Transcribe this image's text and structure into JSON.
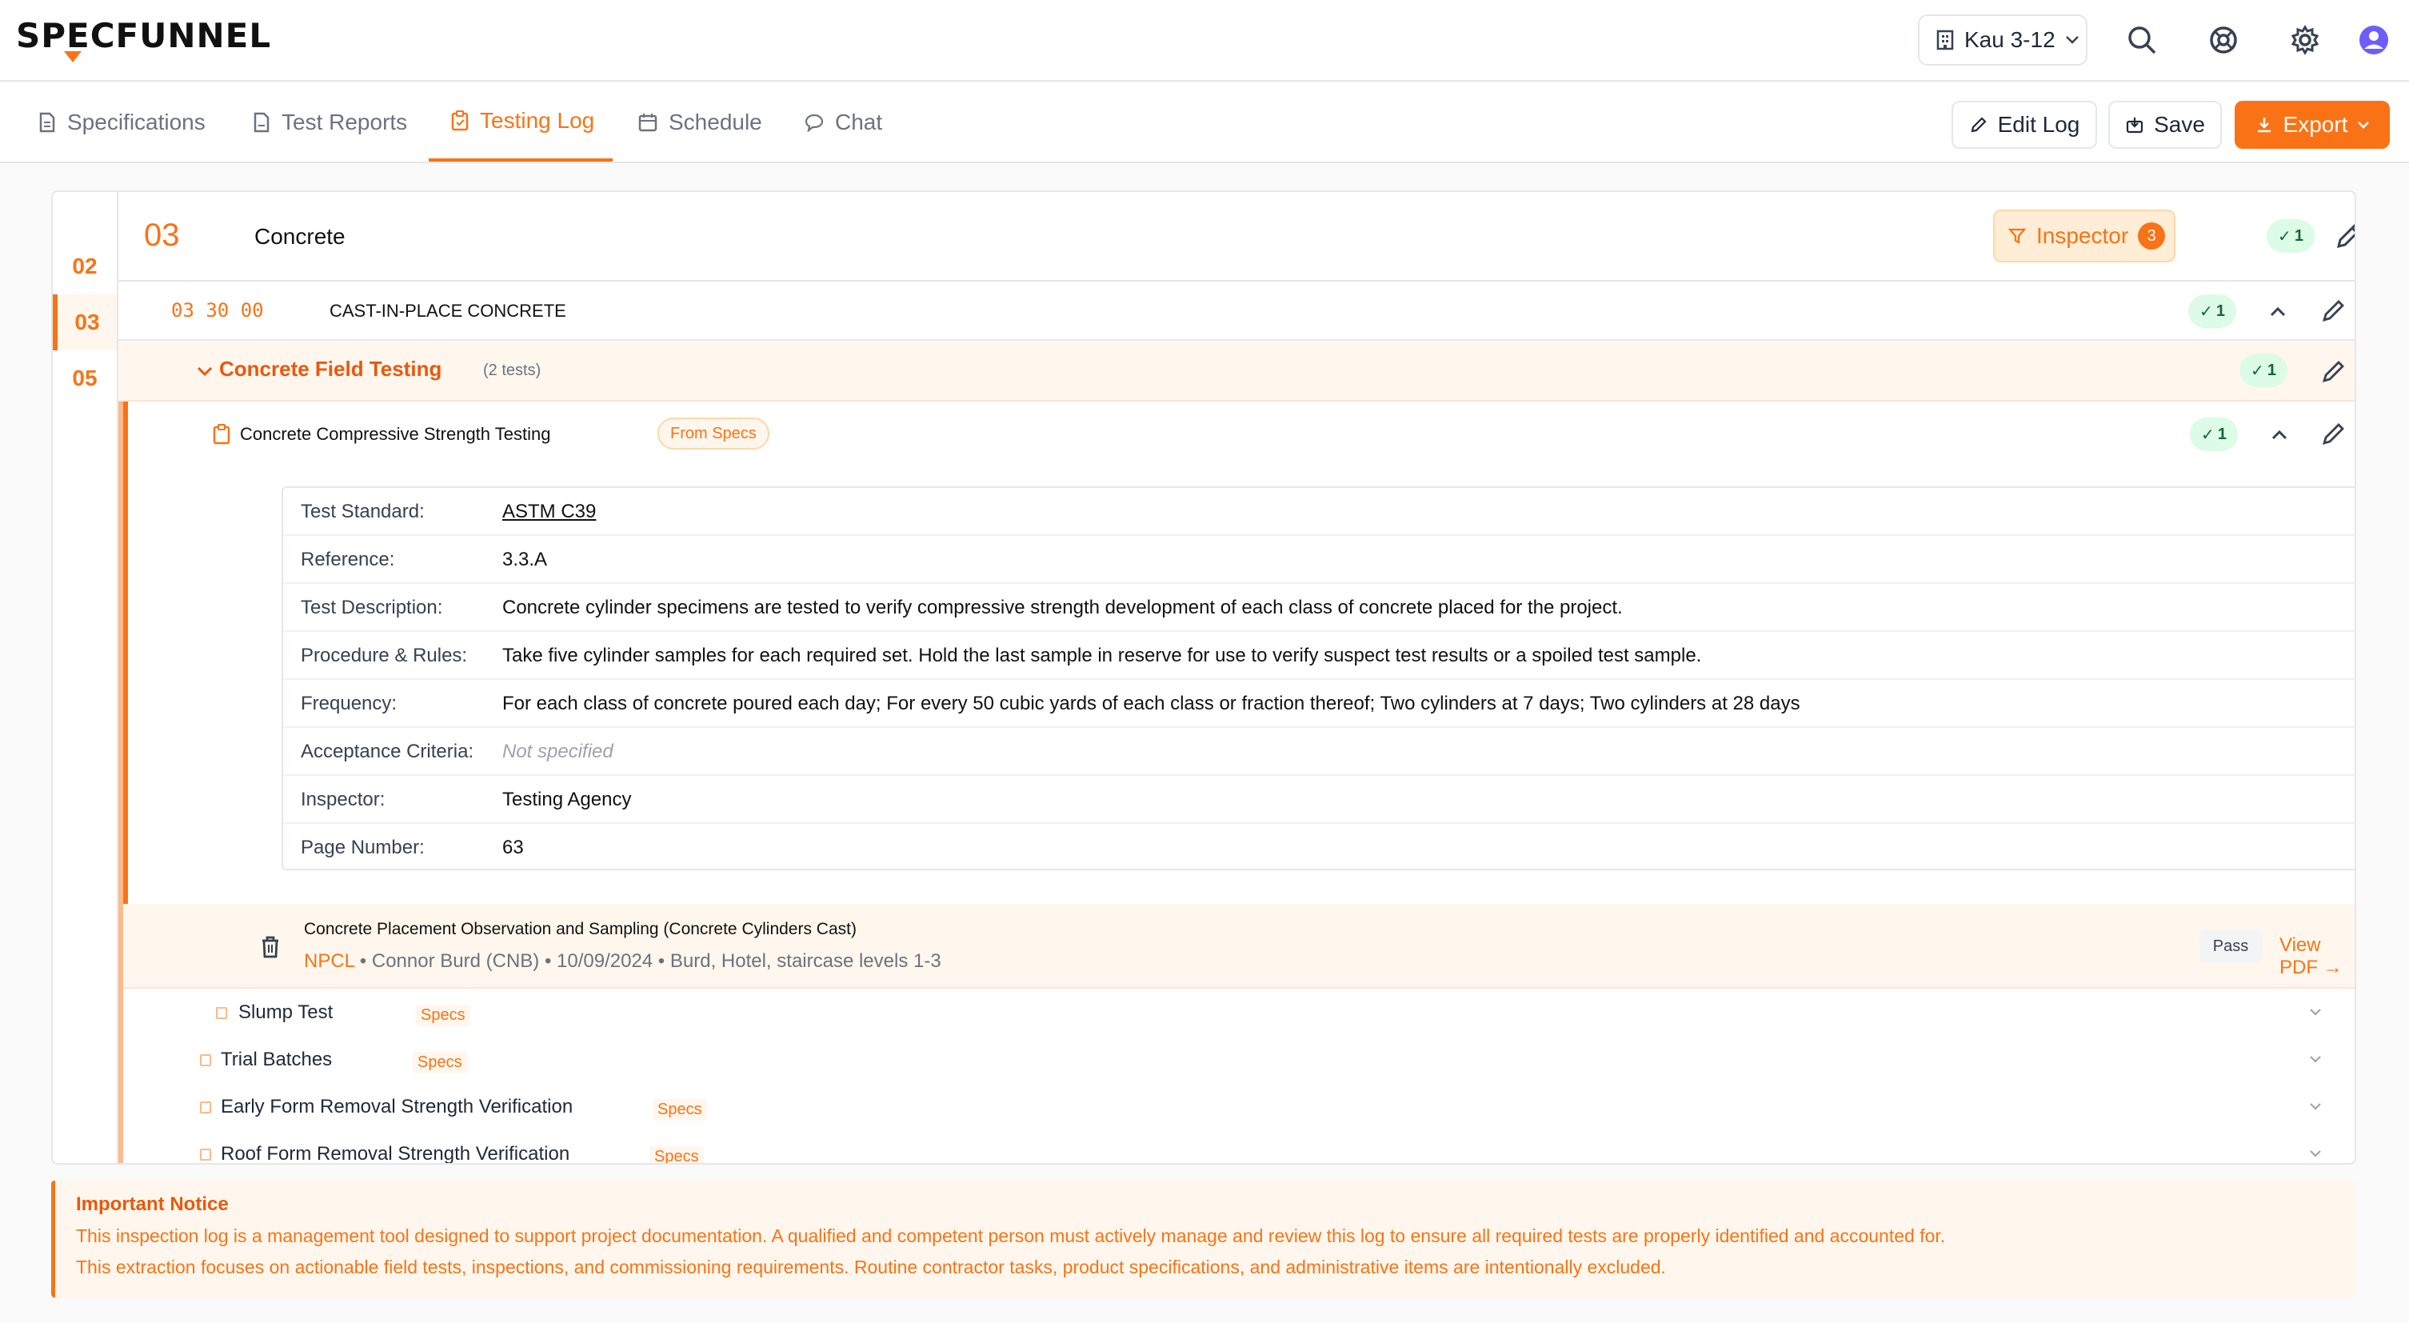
{
  "brand": {
    "logo_text": "SPECFUNNEL",
    "accent": "#f97316"
  },
  "header": {
    "project": "Kau 3-12"
  },
  "tabs": [
    {
      "label": "Specifications",
      "icon": "document-icon"
    },
    {
      "label": "Test Reports",
      "icon": "file-icon"
    },
    {
      "label": "Testing Log",
      "icon": "clipboard-icon",
      "active": true
    },
    {
      "label": "Schedule",
      "icon": "calendar-icon"
    },
    {
      "label": "Chat",
      "icon": "chat-icon"
    }
  ],
  "toolbar": {
    "edit_label": "Edit Log",
    "save_label": "Save",
    "export_label": "Export"
  },
  "sections": [
    "02",
    "03",
    "05"
  ],
  "division": {
    "number": "03",
    "title": "Concrete",
    "filter_label": "Inspector",
    "filter_count": "3",
    "ok_count": "1"
  },
  "subsection": {
    "code": "03 30 00",
    "title": "CAST-IN-PLACE CONCRETE",
    "ok_count": "1"
  },
  "group": {
    "title": "Concrete Field Testing",
    "count": "(2 tests)",
    "ok_count": "1"
  },
  "test": {
    "title": "Concrete Compressive Strength Testing",
    "source_tag": "From Specs",
    "ok_count": "1",
    "details": [
      {
        "label": "Test Standard:",
        "value": "ASTM C39"
      },
      {
        "label": "Reference:",
        "value": "3.3.A"
      },
      {
        "label": "Test Description:",
        "value": "Concrete cylinder specimens are tested to verify compressive strength development of each class of concrete placed for the project."
      },
      {
        "label": "Procedure & Rules:",
        "value": "Take five cylinder samples for each required set. Hold the last sample in reserve for use to verify suspect test results or a spoiled test sample."
      },
      {
        "label": "Frequency:",
        "value": "For each class of concrete poured each day; For every 50 cubic yards of each class or fraction thereof; Two cylinders at 7 days; Two cylinders at 28 days"
      },
      {
        "label": "Acceptance Criteria:",
        "value": "Not specified"
      },
      {
        "label": "Inspector:",
        "value": "Testing Agency"
      },
      {
        "label": "Page Number:",
        "value": "63"
      }
    ],
    "report": {
      "title": "Concrete Placement Observation and Sampling (Concrete Cylinders Cast)",
      "lab": "NPCL",
      "meta": " • Connor Burd (CNB) • 10/09/2024 • Burd, Hotel, staircase levels 1-3",
      "result": "Pass",
      "view_label": "View PDF →"
    }
  },
  "other_tests": [
    {
      "name": "Slump Test",
      "tag": "Specs"
    },
    {
      "name": "Trial Batches",
      "tag": "Specs"
    },
    {
      "name": "Early Form Removal Strength Verification",
      "tag": "Specs"
    },
    {
      "name": "Roof Form Removal Strength Verification",
      "tag": "Specs"
    }
  ],
  "notice": {
    "title": "Important Notice",
    "line1": "This inspection log is a management tool designed to support project documentation. A qualified and competent person must actively manage and review this log to ensure all required tests are properly identified and accounted for.",
    "line2": "This extraction focuses on actionable field tests, inspections, and commissioning requirements. Routine contractor tasks, product specifications, and administrative items are intentionally excluded."
  }
}
